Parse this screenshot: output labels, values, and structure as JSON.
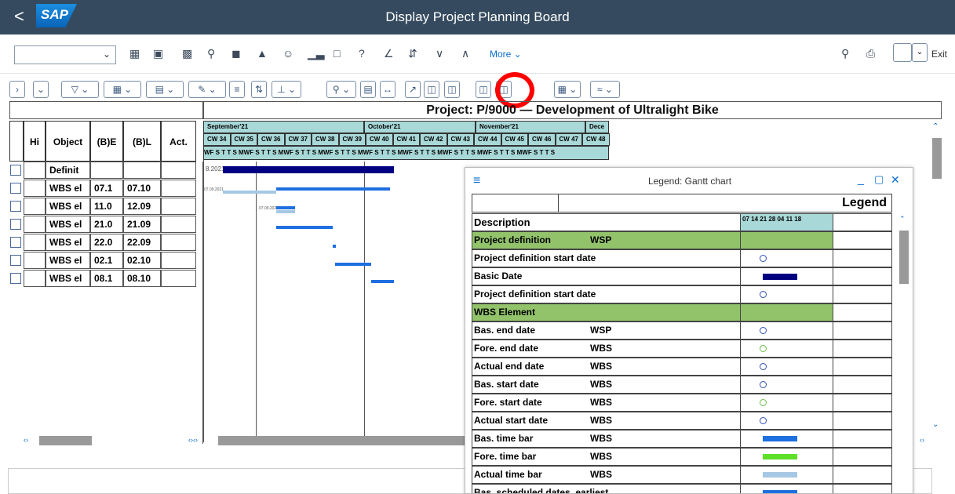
{
  "shell": {
    "back_glyph": "<",
    "logo": "SAP",
    "title": "Display Project Planning Board"
  },
  "toolbar": {
    "more_label": "More",
    "exit_label": "Exit",
    "icons": [
      "grid-icon",
      "grid-outline-icon",
      "save-icon",
      "find-icon",
      "info-icon",
      "hat-icon",
      "person-icon",
      "chart-icon",
      "document-icon",
      "key-icon",
      "graph-icon",
      "refresh-icon",
      "collapse-icon",
      "expand-icon"
    ]
  },
  "project": {
    "title": "Project: P/9000 — Development of Ultralight Bike"
  },
  "table": {
    "headers": [
      "Hi",
      "Object",
      "(B)E",
      "(B)L",
      "Act."
    ],
    "rows": [
      {
        "object": "Definit",
        "be": "",
        "bl": "",
        "act": ""
      },
      {
        "object": "WBS el",
        "be": "07.1",
        "bl": "07.10",
        "act": ""
      },
      {
        "object": "WBS el",
        "be": "11.0",
        "bl": "12.09",
        "act": ""
      },
      {
        "object": "WBS el",
        "be": "21.0",
        "bl": "21.09",
        "act": ""
      },
      {
        "object": "WBS el",
        "be": "22.0",
        "bl": "22.09",
        "act": ""
      },
      {
        "object": "WBS el",
        "be": "02.1",
        "bl": "02.10",
        "act": ""
      },
      {
        "object": "WBS el",
        "be": "08.1",
        "bl": "08.10",
        "act": ""
      }
    ]
  },
  "gantt": {
    "months": [
      "September'21",
      "October'21",
      "November'21",
      "Dece"
    ],
    "weeks": [
      "CW 34",
      "CW 35",
      "CW 36",
      "CW 37",
      "CW 38",
      "CW 39",
      "CW 40",
      "CW 41",
      "CW 42",
      "CW 43",
      "CW 44",
      "CW 45",
      "CW 46",
      "CW 47",
      "CW 48"
    ],
    "days_strip": "WF S T T S MWF S T T S MWF S T T S MWF S T T S MWF S T T S MWF S T T S MWF S T T S MWF S T T S MWF S T T S",
    "labels": [
      "8.2021",
      "07.09.2021",
      "07.09.2021"
    ]
  },
  "legend": {
    "window_title": "Legend: Gantt chart",
    "heading": "Legend",
    "col_description": "Description",
    "col_scale": "07 14 21 28 04 11 18",
    "rows": [
      {
        "desc": "Project definition",
        "type": "WSP",
        "group": true
      },
      {
        "desc": "Project definition start date",
        "type": "",
        "symbol": "circle"
      },
      {
        "desc": "Basic Date",
        "type": "",
        "symbol": "navybar"
      },
      {
        "desc": "Project definition start date",
        "type": "",
        "symbol": "circle"
      },
      {
        "desc": "WBS Element",
        "type": "",
        "group": true
      },
      {
        "desc": "Bas. end date",
        "type": "WSP",
        "symbol": "circle"
      },
      {
        "desc": "Fore. end date",
        "type": "WBS",
        "symbol": "greencircle"
      },
      {
        "desc": "Actual end date",
        "type": "WBS",
        "symbol": "circle"
      },
      {
        "desc": "Bas. start date",
        "type": "WBS",
        "symbol": "circle"
      },
      {
        "desc": "Fore. start date",
        "type": "WBS",
        "symbol": "greencircle"
      },
      {
        "desc": "Actual start date",
        "type": "WBS",
        "symbol": "circle"
      },
      {
        "desc": "Bas. time bar",
        "type": "WBS",
        "symbol": "bluebar"
      },
      {
        "desc": "Fore. time bar",
        "type": "WBS",
        "symbol": "greenbar"
      },
      {
        "desc": "Actual time bar",
        "type": "WBS",
        "symbol": "lightbar"
      },
      {
        "desc": "Bas. scheduled dates, earliest",
        "type": "",
        "symbol": "bluebar"
      }
    ]
  },
  "colors": {
    "shell": "#354a5f",
    "accent": "#0a6ed1",
    "navy": "#000080",
    "bar_blue": "#1e6fe0",
    "bar_light": "#a6c8e4",
    "group_green": "#92c36b",
    "highlight": "#ff0000"
  }
}
